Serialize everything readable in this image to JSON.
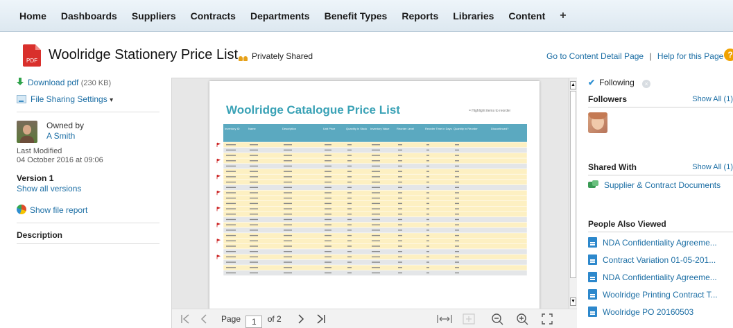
{
  "nav": {
    "items": [
      "Home",
      "Dashboards",
      "Suppliers",
      "Contracts",
      "Departments",
      "Benefit Types",
      "Reports",
      "Libraries",
      "Content"
    ],
    "add": "+"
  },
  "header": {
    "title": "Woolridge Stationery Price List",
    "sharing": "Privately Shared",
    "pdf_icon_text": "PDF",
    "link_detail": "Go to Content Detail Page",
    "separator": "|",
    "link_help": "Help for this Page",
    "help_icon": "?"
  },
  "left": {
    "download": "Download pdf",
    "download_size": "(230 KB)",
    "file_sharing": "File Sharing Settings",
    "file_sharing_caret": "▾",
    "owned_by_label": "Owned by",
    "owner": "A Smith",
    "last_modified_label": "Last Modified",
    "last_modified": "04 October 2016 at 09:06",
    "version": "Version 1",
    "show_versions": "Show all versions",
    "file_report": "Show file report",
    "description_label": "Description"
  },
  "viewer": {
    "doc_title": "Woolridge Catalogue Price List",
    "highlight_note": "= Highlight items to reorder",
    "columns": [
      "Inventory ID",
      "Name",
      "Description",
      "Unit Price",
      "Quantity in Stock",
      "Inventory Value",
      "Reorder Level",
      "Reorder Time in Days",
      "Quantity in Reorder",
      "Discontinued?"
    ],
    "page_label": "Page",
    "page_current": "1",
    "page_total": "of 2",
    "scroll_up": "▲",
    "scroll_down": "▼"
  },
  "right": {
    "following": "Following",
    "followers": "Followers",
    "show_all_1": "Show All (1)",
    "shared_with": "Shared With",
    "show_all_2": "Show All (1)",
    "shared_group": "Supplier & Contract Documents",
    "also_viewed": "People Also Viewed",
    "viewed_items": [
      "NDA Confidentiality Agreeme...",
      "Contract Variation 01-05-201...",
      "NDA Confidentiality Agreeme...",
      "Woolridge Printing Contract T...",
      "Woolridge PO 20160503"
    ]
  },
  "colors": {
    "link": "#1d6fa5",
    "doc_title": "#3aa2b6",
    "table_header": "#5ba9c0",
    "row_highlight": "#fdf0c2",
    "row_plain": "#e4e6e8",
    "flag": "#cc2222"
  }
}
